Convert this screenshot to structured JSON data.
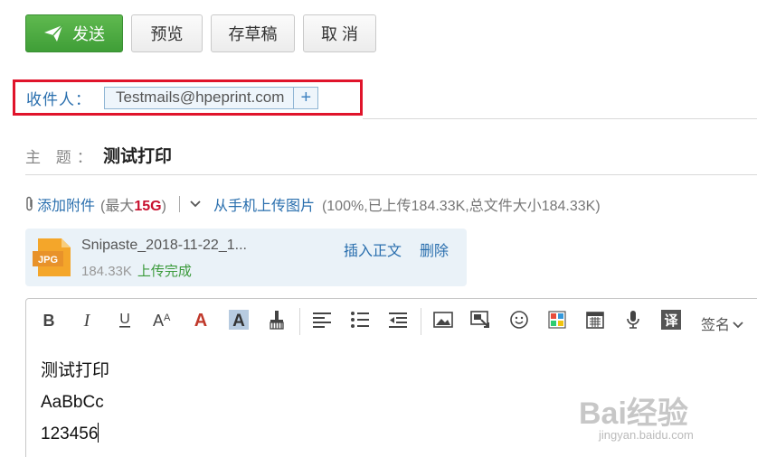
{
  "toolbar": {
    "send_label": "发送",
    "preview_label": "预览",
    "draft_label": "存草稿",
    "cancel_label": "取 消"
  },
  "recipient": {
    "label": "收件人：",
    "chips": [
      "Testmails@hpeprint.com"
    ],
    "add_symbol": "+"
  },
  "subject": {
    "label": "主 题：",
    "value": "测试打印"
  },
  "attachments": {
    "add_link": "添加附件",
    "limit_prefix": "(最大",
    "limit_value": "15G",
    "limit_suffix": ")",
    "upload_link": "从手机上传图片",
    "upload_status": "(100%,已上传184.33K,总文件大小184.33K)",
    "files": [
      {
        "icon_text": "JPG",
        "name": "Snipaste_2018-11-22_1...",
        "size": "184.33K",
        "status": "上传完成",
        "insert_label": "插入正文",
        "delete_label": "删除"
      }
    ]
  },
  "editor": {
    "toolbar_icons": [
      "bold-icon",
      "italic-icon",
      "underline-icon",
      "font-size-icon",
      "font-color-icon",
      "highlight-icon",
      "format-brush-icon",
      "align-left-icon",
      "list-icon",
      "indent-icon",
      "image-icon",
      "screenshot-icon",
      "emoji-icon",
      "mosaic-icon",
      "calendar-icon",
      "microphone-icon",
      "translate-icon"
    ],
    "signature_label": "签名",
    "lines": [
      "测试打印",
      "AaBbCc",
      "123456"
    ]
  },
  "watermark": {
    "brand": "Bai经验",
    "url": "jingyan.baidu.com"
  },
  "colors": {
    "send_green": "#4aa841",
    "highlight_red": "#e0142b",
    "link_blue": "#2a6fae"
  }
}
